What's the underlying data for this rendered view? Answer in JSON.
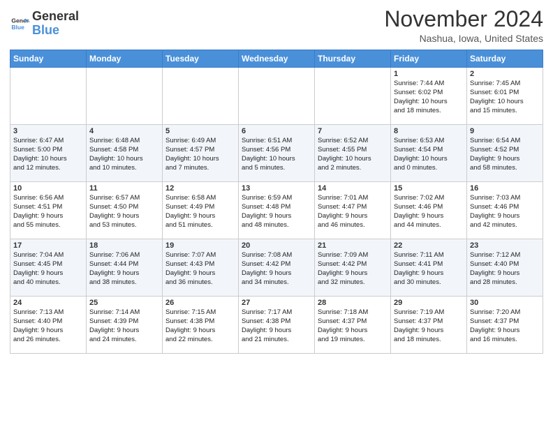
{
  "header": {
    "logo_line1": "General",
    "logo_line2": "Blue",
    "month": "November 2024",
    "location": "Nashua, Iowa, United States"
  },
  "weekdays": [
    "Sunday",
    "Monday",
    "Tuesday",
    "Wednesday",
    "Thursday",
    "Friday",
    "Saturday"
  ],
  "weeks": [
    [
      {
        "day": "",
        "text": ""
      },
      {
        "day": "",
        "text": ""
      },
      {
        "day": "",
        "text": ""
      },
      {
        "day": "",
        "text": ""
      },
      {
        "day": "",
        "text": ""
      },
      {
        "day": "1",
        "text": "Sunrise: 7:44 AM\nSunset: 6:02 PM\nDaylight: 10 hours\nand 18 minutes."
      },
      {
        "day": "2",
        "text": "Sunrise: 7:45 AM\nSunset: 6:01 PM\nDaylight: 10 hours\nand 15 minutes."
      }
    ],
    [
      {
        "day": "3",
        "text": "Sunrise: 6:47 AM\nSunset: 5:00 PM\nDaylight: 10 hours\nand 12 minutes."
      },
      {
        "day": "4",
        "text": "Sunrise: 6:48 AM\nSunset: 4:58 PM\nDaylight: 10 hours\nand 10 minutes."
      },
      {
        "day": "5",
        "text": "Sunrise: 6:49 AM\nSunset: 4:57 PM\nDaylight: 10 hours\nand 7 minutes."
      },
      {
        "day": "6",
        "text": "Sunrise: 6:51 AM\nSunset: 4:56 PM\nDaylight: 10 hours\nand 5 minutes."
      },
      {
        "day": "7",
        "text": "Sunrise: 6:52 AM\nSunset: 4:55 PM\nDaylight: 10 hours\nand 2 minutes."
      },
      {
        "day": "8",
        "text": "Sunrise: 6:53 AM\nSunset: 4:54 PM\nDaylight: 10 hours\nand 0 minutes."
      },
      {
        "day": "9",
        "text": "Sunrise: 6:54 AM\nSunset: 4:52 PM\nDaylight: 9 hours\nand 58 minutes."
      }
    ],
    [
      {
        "day": "10",
        "text": "Sunrise: 6:56 AM\nSunset: 4:51 PM\nDaylight: 9 hours\nand 55 minutes."
      },
      {
        "day": "11",
        "text": "Sunrise: 6:57 AM\nSunset: 4:50 PM\nDaylight: 9 hours\nand 53 minutes."
      },
      {
        "day": "12",
        "text": "Sunrise: 6:58 AM\nSunset: 4:49 PM\nDaylight: 9 hours\nand 51 minutes."
      },
      {
        "day": "13",
        "text": "Sunrise: 6:59 AM\nSunset: 4:48 PM\nDaylight: 9 hours\nand 48 minutes."
      },
      {
        "day": "14",
        "text": "Sunrise: 7:01 AM\nSunset: 4:47 PM\nDaylight: 9 hours\nand 46 minutes."
      },
      {
        "day": "15",
        "text": "Sunrise: 7:02 AM\nSunset: 4:46 PM\nDaylight: 9 hours\nand 44 minutes."
      },
      {
        "day": "16",
        "text": "Sunrise: 7:03 AM\nSunset: 4:46 PM\nDaylight: 9 hours\nand 42 minutes."
      }
    ],
    [
      {
        "day": "17",
        "text": "Sunrise: 7:04 AM\nSunset: 4:45 PM\nDaylight: 9 hours\nand 40 minutes."
      },
      {
        "day": "18",
        "text": "Sunrise: 7:06 AM\nSunset: 4:44 PM\nDaylight: 9 hours\nand 38 minutes."
      },
      {
        "day": "19",
        "text": "Sunrise: 7:07 AM\nSunset: 4:43 PM\nDaylight: 9 hours\nand 36 minutes."
      },
      {
        "day": "20",
        "text": "Sunrise: 7:08 AM\nSunset: 4:42 PM\nDaylight: 9 hours\nand 34 minutes."
      },
      {
        "day": "21",
        "text": "Sunrise: 7:09 AM\nSunset: 4:42 PM\nDaylight: 9 hours\nand 32 minutes."
      },
      {
        "day": "22",
        "text": "Sunrise: 7:11 AM\nSunset: 4:41 PM\nDaylight: 9 hours\nand 30 minutes."
      },
      {
        "day": "23",
        "text": "Sunrise: 7:12 AM\nSunset: 4:40 PM\nDaylight: 9 hours\nand 28 minutes."
      }
    ],
    [
      {
        "day": "24",
        "text": "Sunrise: 7:13 AM\nSunset: 4:40 PM\nDaylight: 9 hours\nand 26 minutes."
      },
      {
        "day": "25",
        "text": "Sunrise: 7:14 AM\nSunset: 4:39 PM\nDaylight: 9 hours\nand 24 minutes."
      },
      {
        "day": "26",
        "text": "Sunrise: 7:15 AM\nSunset: 4:38 PM\nDaylight: 9 hours\nand 22 minutes."
      },
      {
        "day": "27",
        "text": "Sunrise: 7:17 AM\nSunset: 4:38 PM\nDaylight: 9 hours\nand 21 minutes."
      },
      {
        "day": "28",
        "text": "Sunrise: 7:18 AM\nSunset: 4:37 PM\nDaylight: 9 hours\nand 19 minutes."
      },
      {
        "day": "29",
        "text": "Sunrise: 7:19 AM\nSunset: 4:37 PM\nDaylight: 9 hours\nand 18 minutes."
      },
      {
        "day": "30",
        "text": "Sunrise: 7:20 AM\nSunset: 4:37 PM\nDaylight: 9 hours\nand 16 minutes."
      }
    ]
  ]
}
